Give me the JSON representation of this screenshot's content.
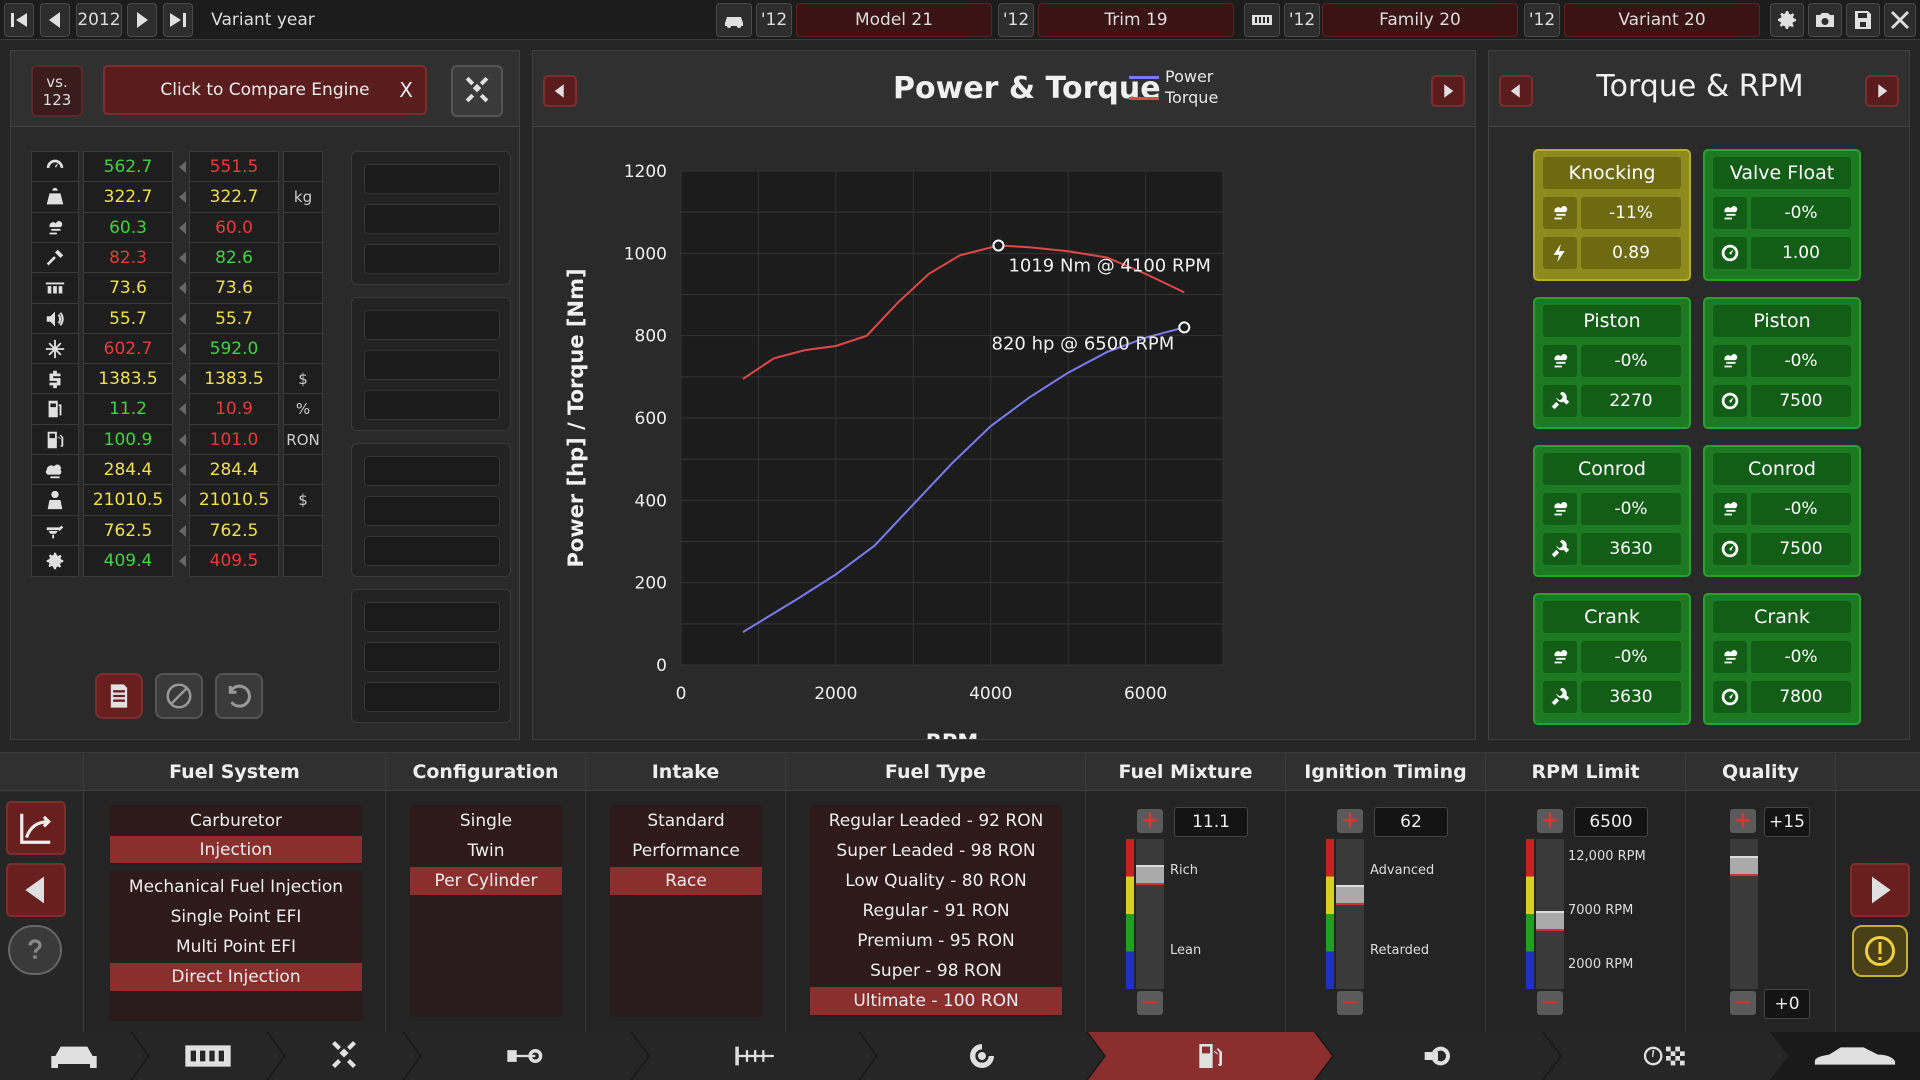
{
  "topbar": {
    "year": "2012",
    "variant_year_label": "Variant year",
    "model_year": "'12",
    "model": "Model 21",
    "trim_year": "'12",
    "trim": "Trim 19",
    "family_year": "'12",
    "family": "Family 20",
    "variant_year": "'12",
    "variant": "Variant 20"
  },
  "compare": {
    "vs_label": "vs.",
    "vs_number": "123",
    "button_label": "Click to Compare Engine",
    "close_label": "X"
  },
  "stats": [
    {
      "icon": "speedometer-icon",
      "a": "562.7",
      "a_color": "g",
      "b": "551.5",
      "b_color": "r",
      "unit": ""
    },
    {
      "icon": "weight-icon",
      "a": "322.7",
      "a_color": "y",
      "b": "322.7",
      "b_color": "y",
      "unit": "kg"
    },
    {
      "icon": "smoke-icon",
      "a": "60.3",
      "a_color": "g",
      "b": "60.0",
      "b_color": "r",
      "unit": ""
    },
    {
      "icon": "drivability-icon",
      "a": "82.3",
      "a_color": "r",
      "b": "82.6",
      "b_color": "g",
      "unit": ""
    },
    {
      "icon": "smoothness-icon",
      "a": "73.6",
      "a_color": "y",
      "b": "73.6",
      "b_color": "y",
      "unit": ""
    },
    {
      "icon": "noise-icon",
      "a": "55.7",
      "a_color": "y",
      "b": "55.7",
      "b_color": "y",
      "unit": ""
    },
    {
      "icon": "cooling-icon",
      "a": "602.7",
      "a_color": "r",
      "b": "592.0",
      "b_color": "g",
      "unit": ""
    },
    {
      "icon": "cost-icon",
      "a": "1383.5",
      "a_color": "y",
      "b": "1383.5",
      "b_color": "y",
      "unit": "$"
    },
    {
      "icon": "fuel-efficiency-icon",
      "a": "11.2",
      "a_color": "g",
      "b": "10.9",
      "b_color": "r",
      "unit": "%"
    },
    {
      "icon": "fuel-pump-icon",
      "a": "100.9",
      "a_color": "g",
      "b": "101.0",
      "b_color": "r",
      "unit": "RON"
    },
    {
      "icon": "emissions-icon",
      "a": "284.4",
      "a_color": "y",
      "b": "284.4",
      "b_color": "y",
      "unit": ""
    },
    {
      "icon": "engineering-icon",
      "a": "21010.5",
      "a_color": "y",
      "b": "21010.5",
      "b_color": "y",
      "unit": "$"
    },
    {
      "icon": "production-icon",
      "a": "762.5",
      "a_color": "y",
      "b": "762.5",
      "b_color": "y",
      "unit": ""
    },
    {
      "icon": "service-icon",
      "a": "409.4",
      "a_color": "g",
      "b": "409.5",
      "b_color": "r",
      "unit": ""
    }
  ],
  "chart_panel": {
    "title": "Power & Torque",
    "legend_power": "Power",
    "legend_torque": "Torque",
    "annotation_torque": "1019 Nm @ 4100 RPM",
    "annotation_power": "820 hp @ 6500 RPM"
  },
  "chart_data": {
    "type": "line",
    "xlabel": "RPM",
    "ylabel": "Power [hp] / Torque [Nm]",
    "xlim": [
      0,
      7000
    ],
    "ylim": [
      0,
      1200
    ],
    "xticks": [
      0,
      2000,
      4000,
      6000
    ],
    "yticks": [
      0,
      200,
      400,
      600,
      800,
      1000,
      1200
    ],
    "grid": true,
    "legend": "top-right",
    "series": [
      {
        "name": "Power",
        "color": "#7b7bf0",
        "x": [
          800,
          1500,
          2000,
          2500,
          3000,
          3500,
          4000,
          4500,
          5000,
          5500,
          6000,
          6500
        ],
        "y": [
          80,
          160,
          220,
          290,
          390,
          490,
          580,
          650,
          710,
          760,
          795,
          820
        ]
      },
      {
        "name": "Torque",
        "color": "#e04848",
        "x": [
          800,
          1200,
          1600,
          2000,
          2400,
          2800,
          3200,
          3600,
          4100,
          4500,
          5000,
          5500,
          6000,
          6500
        ],
        "y": [
          695,
          745,
          765,
          775,
          800,
          880,
          950,
          995,
          1019,
          1015,
          1005,
          990,
          950,
          905
        ]
      }
    ]
  },
  "rpm_panel": {
    "title": "Torque & RPM",
    "cards": [
      {
        "title": "Knocking",
        "color": "y",
        "icon1": "smoke-icon",
        "val1": "-11%",
        "icon2": "spark-icon",
        "val2": "0.89"
      },
      {
        "title": "Valve Float",
        "color": "g",
        "icon1": "smoke-icon",
        "val1": "-0%",
        "icon2": "gauge-icon",
        "val2": "1.00"
      },
      {
        "title": "Piston",
        "color": "g",
        "icon1": "smoke-icon",
        "val1": "-0%",
        "icon2": "wrench-icon",
        "val2": "2270"
      },
      {
        "title": "Piston",
        "color": "g",
        "icon1": "smoke-icon",
        "val1": "-0%",
        "icon2": "gauge-icon",
        "val2": "7500"
      },
      {
        "title": "Conrod",
        "color": "g",
        "icon1": "smoke-icon",
        "val1": "-0%",
        "icon2": "wrench-icon",
        "val2": "3630"
      },
      {
        "title": "Conrod",
        "color": "g",
        "icon1": "smoke-icon",
        "val1": "-0%",
        "icon2": "gauge-icon",
        "val2": "7500"
      },
      {
        "title": "Crank",
        "color": "g",
        "icon1": "smoke-icon",
        "val1": "-0%",
        "icon2": "wrench-icon",
        "val2": "3630"
      },
      {
        "title": "Crank",
        "color": "g",
        "icon1": "smoke-icon",
        "val1": "-0%",
        "icon2": "gauge-icon",
        "val2": "7800"
      }
    ]
  },
  "bottom": {
    "fuel_system": {
      "header": "Fuel System",
      "group1": [
        "Carburetor",
        "Injection"
      ],
      "group1_selected": 1,
      "group2": [
        "Mechanical Fuel Injection",
        "Single Point EFI",
        "Multi Point EFI",
        "Direct Injection"
      ],
      "group2_selected": 3
    },
    "configuration": {
      "header": "Configuration",
      "options": [
        "Single",
        "Twin",
        "Per Cylinder"
      ],
      "selected": 2
    },
    "intake": {
      "header": "Intake",
      "options": [
        "Standard",
        "Performance",
        "Race"
      ],
      "selected": 2
    },
    "fuel_type": {
      "header": "Fuel Type",
      "options": [
        "Regular Leaded - 92 RON",
        "Super Leaded - 98 RON",
        "Low Quality - 80 RON",
        "Regular - 91 RON",
        "Premium - 95 RON",
        "Super - 98 RON",
        "Ultimate - 100 RON"
      ],
      "selected": 6
    },
    "fuel_mixture": {
      "header": "Fuel Mixture",
      "value": "11.1",
      "label_top": "Rich",
      "label_bottom": "Lean",
      "level": 0.8
    },
    "ignition_timing": {
      "header": "Ignition Timing",
      "value": "62",
      "label_top": "Advanced",
      "label_bottom": "Retarded",
      "level": 0.65
    },
    "rpm_limit": {
      "header": "RPM Limit",
      "value": "6500",
      "label_top": "12,000 RPM",
      "label_mid": "7000 RPM",
      "label_bottom": "2000 RPM",
      "level": 0.45
    },
    "quality": {
      "header": "Quality",
      "value_top": "+15",
      "value_bottom": "+0",
      "level": 0.87
    }
  },
  "colors": {
    "accent": "#8a2e2e",
    "power": "#7b7bf0",
    "torque": "#e04848",
    "good": "#3fd43f",
    "bad": "#e83a3a",
    "neutral": "#f0e04a"
  }
}
